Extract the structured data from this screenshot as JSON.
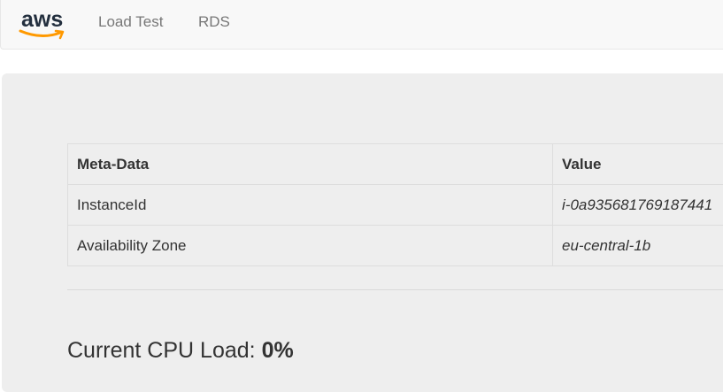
{
  "navbar": {
    "brand": "aws",
    "links": [
      {
        "label": "Load Test"
      },
      {
        "label": "RDS"
      }
    ]
  },
  "colors": {
    "navbar_bg": "#f8f8f8",
    "jumbotron_bg": "#eeeeee",
    "aws_text": "#232f3e",
    "aws_smile": "#ff9900",
    "nav_link": "#777777"
  },
  "icons": {
    "brand_logo": "aws-logo-icon"
  },
  "table": {
    "headers": [
      "Meta-Data",
      "Value"
    ],
    "rows": [
      {
        "key": "InstanceId",
        "value": "i-0a935681769187441"
      },
      {
        "key": "Availability Zone",
        "value": "eu-central-1b"
      }
    ]
  },
  "cpu": {
    "label": "Current CPU Load:",
    "value": "0%"
  }
}
